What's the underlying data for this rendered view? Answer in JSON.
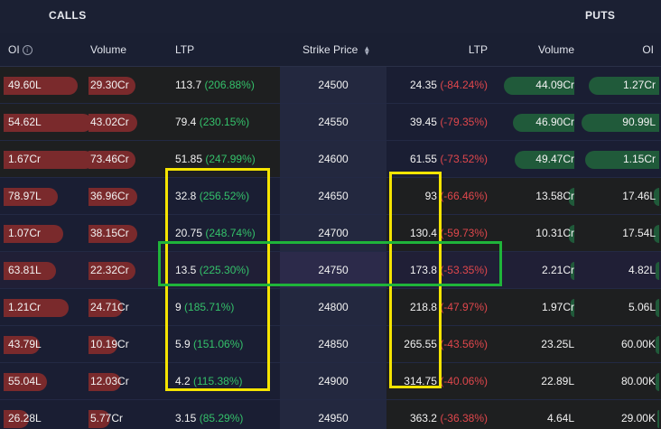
{
  "header": {
    "calls": "CALLS",
    "puts": "PUTS"
  },
  "columns": {
    "call_oi": "OI",
    "call_volume": "Volume",
    "call_ltp": "LTP",
    "strike": "Strike Price",
    "put_ltp": "LTP",
    "put_volume": "Volume",
    "put_oi": "OI"
  },
  "colors": {
    "positive": "#34c06a",
    "negative": "#e0474c",
    "highlight_yellow": "#f5e400",
    "highlight_green": "#1fb43a"
  },
  "rows": [
    {
      "call_oi": "49.60L",
      "call_vol": "29.30Cr",
      "call_ltp": "113.7",
      "call_chg": "(206.88%)",
      "strike": "24500",
      "put_ltp": "24.35",
      "put_chg": "(-84.24%)",
      "put_vol": "44.09Cr",
      "put_oi": "1.27Cr"
    },
    {
      "call_oi": "54.62L",
      "call_vol": "43.02Cr",
      "call_ltp": "79.4",
      "call_chg": "(230.15%)",
      "strike": "24550",
      "put_ltp": "39.45",
      "put_chg": "(-79.35%)",
      "put_vol": "46.90Cr",
      "put_oi": "90.99L"
    },
    {
      "call_oi": "1.67Cr",
      "call_vol": "73.46Cr",
      "call_ltp": "51.85",
      "call_chg": "(247.99%)",
      "strike": "24600",
      "put_ltp": "61.55",
      "put_chg": "(-73.52%)",
      "put_vol": "49.47Cr",
      "put_oi": "1.15Cr"
    },
    {
      "call_oi": "78.97L",
      "call_vol": "36.96Cr",
      "call_ltp": "32.8",
      "call_chg": "(256.52%)",
      "strike": "24650",
      "put_ltp": "93",
      "put_chg": "(-66.46%)",
      "put_vol": "13.58Cr",
      "put_oi": "17.46L"
    },
    {
      "call_oi": "1.07Cr",
      "call_vol": "38.15Cr",
      "call_ltp": "20.75",
      "call_chg": "(248.74%)",
      "strike": "24700",
      "put_ltp": "130.4",
      "put_chg": "(-59.73%)",
      "put_vol": "10.31Cr",
      "put_oi": "17.54L"
    },
    {
      "call_oi": "63.81L",
      "call_vol": "22.32Cr",
      "call_ltp": "13.5",
      "call_chg": "(225.30%)",
      "strike": "24750",
      "put_ltp": "173.8",
      "put_chg": "(-53.35%)",
      "put_vol": "2.21Cr",
      "put_oi": "4.82L"
    },
    {
      "call_oi": "1.21Cr",
      "call_vol": "24.71Cr",
      "call_ltp": "9",
      "call_chg": "(185.71%)",
      "strike": "24800",
      "put_ltp": "218.8",
      "put_chg": "(-47.97%)",
      "put_vol": "1.97Cr",
      "put_oi": "5.06L"
    },
    {
      "call_oi": "43.79L",
      "call_vol": "10.19Cr",
      "call_ltp": "5.9",
      "call_chg": "(151.06%)",
      "strike": "24850",
      "put_ltp": "265.55",
      "put_chg": "(-43.56%)",
      "put_vol": "23.25L",
      "put_oi": "60.00K"
    },
    {
      "call_oi": "55.04L",
      "call_vol": "12.03Cr",
      "call_ltp": "4.2",
      "call_chg": "(115.38%)",
      "strike": "24900",
      "put_ltp": "314.75",
      "put_chg": "(-40.06%)",
      "put_vol": "22.89L",
      "put_oi": "80.00K"
    },
    {
      "call_oi": "26.28L",
      "call_vol": "5.77Cr",
      "call_ltp": "3.15",
      "call_chg": "(85.29%)",
      "strike": "24950",
      "put_ltp": "363.2",
      "put_chg": "(-36.38%)",
      "put_vol": "4.64L",
      "put_oi": "29.00K"
    }
  ]
}
